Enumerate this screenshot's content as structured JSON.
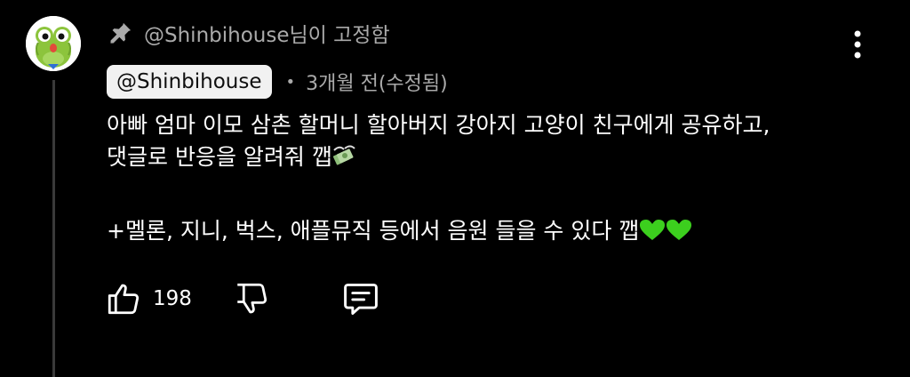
{
  "comment": {
    "pinned_text": "@Shinbihouse님이 고정함",
    "author": "@Shinbihouse",
    "separator": "•",
    "timestamp": "3개월 전(수정됨)",
    "body_line1": "아빠 엄마 이모 삼촌 할머니 할아버지 강아지 고양이 친구에게 공유하고,",
    "body_line2": "댓글로 반응을 알려줘 깹",
    "body_line3": "+멜론, 지니, 벅스, 애플뮤직 등에서 음원 들을 수 있다 깹",
    "like_count": "198"
  },
  "icons": {
    "pin": "pin-icon",
    "more": "more-vertical-icon",
    "like": "thumbs-up-icon",
    "dislike": "thumbs-down-icon",
    "reply": "comment-reply-icon",
    "money_emoji": "money-with-wings-emoji",
    "heart_emoji": "green-heart-emoji"
  },
  "colors": {
    "background": "#000000",
    "secondary_text": "#aaaaaa",
    "author_chip_bg": "#f1f1f1",
    "heart": "#3ccf1e"
  }
}
